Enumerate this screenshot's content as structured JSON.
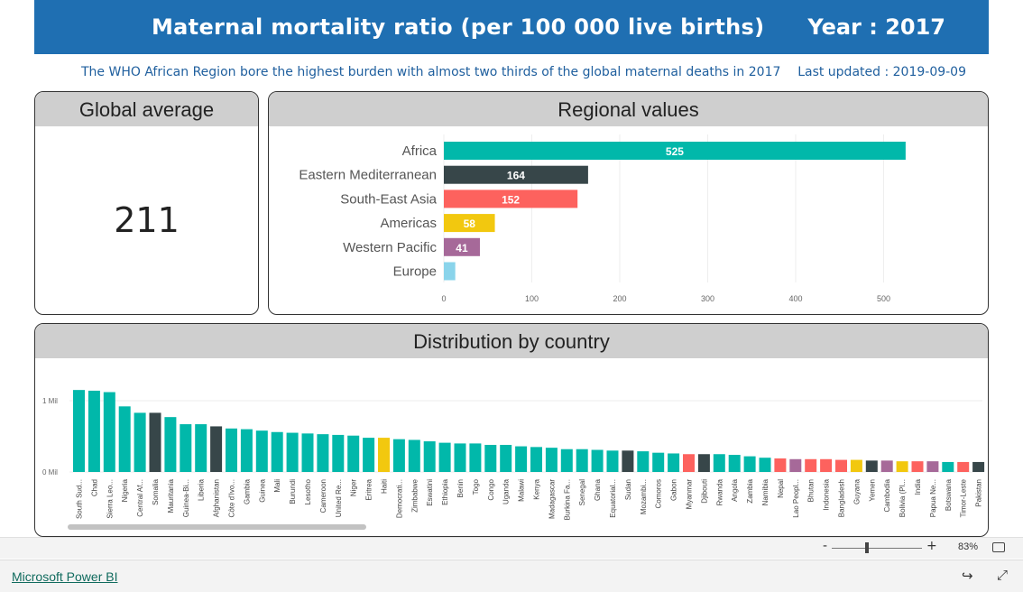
{
  "header": {
    "title": "Maternal mortality ratio (per 100 000 live births)",
    "year": "Year : 2017",
    "subtitle": "The WHO African Region bore the highest burden with almost two thirds of the global maternal deaths in 2017",
    "updated": "Last updated : 2019-09-09"
  },
  "global_panel": {
    "title": "Global average",
    "value": "211"
  },
  "regional_panel": {
    "title": "Regional values"
  },
  "country_panel": {
    "title": "Distribution by country"
  },
  "colors": {
    "header": "#1f6fb2",
    "africa": "#01b8aa",
    "emr": "#374649",
    "sear": "#fd625e",
    "amr": "#f2c80f",
    "wpr": "#a66999",
    "eur": "#8ad4eb"
  },
  "chart_data": [
    {
      "type": "bar",
      "orientation": "horizontal",
      "title": "Regional values",
      "categories": [
        "Africa",
        "Eastern Mediterranean",
        "South-East Asia",
        "Americas",
        "Western Pacific",
        "Europe"
      ],
      "values": [
        525,
        164,
        152,
        58,
        41,
        13
      ],
      "data_labels": [
        "525",
        "164",
        "152",
        "58",
        "41",
        ""
      ],
      "colors": [
        "#01b8aa",
        "#374649",
        "#fd625e",
        "#f2c80f",
        "#a66999",
        "#8ad4eb"
      ],
      "xlim": [
        0,
        560
      ],
      "x_ticks": [
        0,
        100,
        200,
        300,
        400,
        500
      ],
      "grid": true
    },
    {
      "type": "bar",
      "title": "Distribution by country",
      "y_ticks": [
        "0 Mil",
        "1 Mil"
      ],
      "ylim": [
        0,
        1.25
      ],
      "grid": true,
      "categories": [
        "South Sud...",
        "Chad",
        "Sierra Leo...",
        "Nigeria",
        "Central Af...",
        "Somalia",
        "Mauritania",
        "Guinea-Bi...",
        "Liberia",
        "Afghanistan",
        "Côte d'Ivo...",
        "Gambia",
        "Guinea",
        "Mali",
        "Burundi",
        "Lesotho",
        "Cameroon",
        "United Re...",
        "Niger",
        "Eritrea",
        "Haiti",
        "Democrati...",
        "Zimbabwe",
        "Eswatini",
        "Ethiopia",
        "Benin",
        "Togo",
        "Congo",
        "Uganda",
        "Malawi",
        "Kenya",
        "Madagascar",
        "Burkina Fa...",
        "Senegal",
        "Ghana",
        "Equatorial...",
        "Sudan",
        "Mozambi...",
        "Comoros",
        "Gabon",
        "Myanmar",
        "Djibouti",
        "Rwanda",
        "Angola",
        "Zambia",
        "Namibia",
        "Nepal",
        "Lao Peopl...",
        "Bhutan",
        "Indonesia",
        "Bangladesh",
        "Guyana",
        "Yemen",
        "Cambodia",
        "Bolivia (Pl...",
        "India",
        "Papua Ne...",
        "Botswana",
        "Timor-Leste",
        "Pakistan"
      ],
      "values": [
        1.15,
        1.14,
        1.12,
        0.92,
        0.83,
        0.83,
        0.77,
        0.67,
        0.67,
        0.64,
        0.61,
        0.6,
        0.58,
        0.56,
        0.55,
        0.54,
        0.53,
        0.52,
        0.51,
        0.48,
        0.48,
        0.46,
        0.45,
        0.43,
        0.41,
        0.4,
        0.4,
        0.38,
        0.38,
        0.36,
        0.35,
        0.34,
        0.32,
        0.32,
        0.31,
        0.3,
        0.3,
        0.29,
        0.27,
        0.26,
        0.25,
        0.25,
        0.25,
        0.24,
        0.22,
        0.2,
        0.19,
        0.18,
        0.18,
        0.18,
        0.17,
        0.17,
        0.16,
        0.16,
        0.15,
        0.15,
        0.15,
        0.14,
        0.14,
        0.14
      ],
      "bar_colors": [
        "#01b8aa",
        "#01b8aa",
        "#01b8aa",
        "#01b8aa",
        "#01b8aa",
        "#374649",
        "#01b8aa",
        "#01b8aa",
        "#01b8aa",
        "#374649",
        "#01b8aa",
        "#01b8aa",
        "#01b8aa",
        "#01b8aa",
        "#01b8aa",
        "#01b8aa",
        "#01b8aa",
        "#01b8aa",
        "#01b8aa",
        "#01b8aa",
        "#f2c80f",
        "#01b8aa",
        "#01b8aa",
        "#01b8aa",
        "#01b8aa",
        "#01b8aa",
        "#01b8aa",
        "#01b8aa",
        "#01b8aa",
        "#01b8aa",
        "#01b8aa",
        "#01b8aa",
        "#01b8aa",
        "#01b8aa",
        "#01b8aa",
        "#01b8aa",
        "#374649",
        "#01b8aa",
        "#01b8aa",
        "#01b8aa",
        "#fd625e",
        "#374649",
        "#01b8aa",
        "#01b8aa",
        "#01b8aa",
        "#01b8aa",
        "#fd625e",
        "#a66999",
        "#fd625e",
        "#fd625e",
        "#fd625e",
        "#f2c80f",
        "#374649",
        "#a66999",
        "#f2c80f",
        "#fd625e",
        "#a66999",
        "#01b8aa",
        "#fd625e",
        "#374649"
      ]
    }
  ],
  "footer": {
    "link": "Microsoft Power BI",
    "zoom": "83%",
    "zoom_minus": "-",
    "zoom_plus": "+"
  }
}
